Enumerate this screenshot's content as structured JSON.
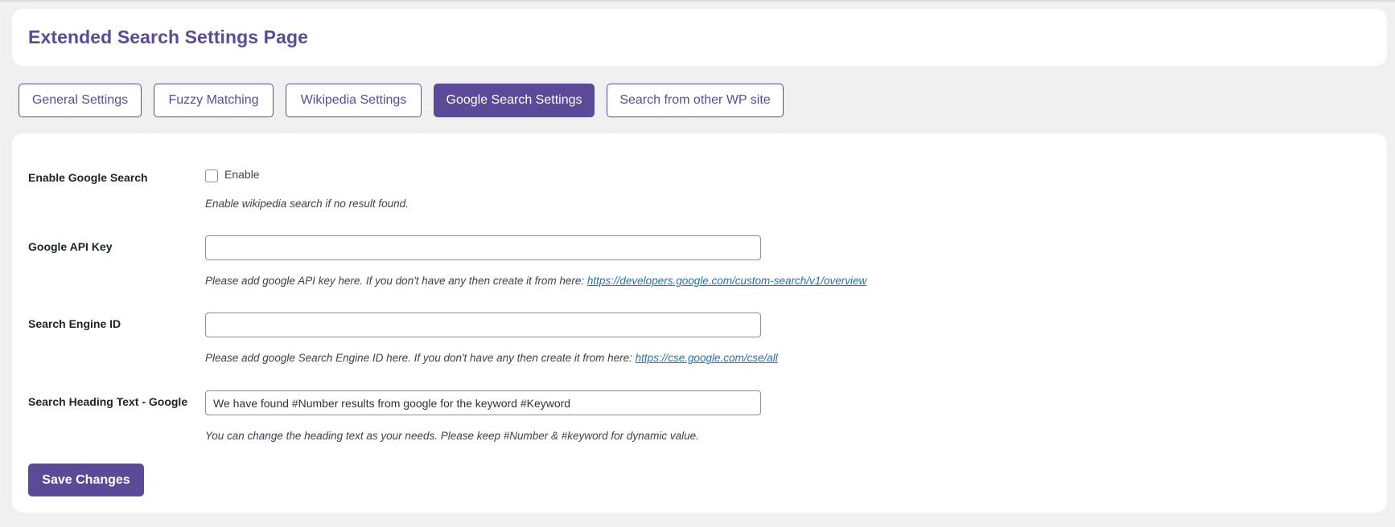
{
  "page": {
    "title": "Extended Search Settings Page"
  },
  "tabs": [
    {
      "label": "General Settings",
      "active": false
    },
    {
      "label": "Fuzzy Matching",
      "active": false
    },
    {
      "label": "Wikipedia Settings",
      "active": false
    },
    {
      "label": "Google Search Settings",
      "active": true
    },
    {
      "label": "Search from other WP site",
      "active": false
    }
  ],
  "form": {
    "enable_google": {
      "label": "Enable Google Search",
      "checkbox_label": "Enable",
      "checked": false,
      "description": "Enable wikipedia search if no result found."
    },
    "api_key": {
      "label": "Google API Key",
      "value": "",
      "description": "Please add google API key here. If you don't have any then create it from here: ",
      "link_text": "https://developers.google.com/custom-search/v1/overview"
    },
    "engine_id": {
      "label": "Search Engine ID",
      "value": "",
      "description": "Please add google Search Engine ID here. If you don't have any then create it from here: ",
      "link_text": "https://cse.google.com/cse/all"
    },
    "heading_text": {
      "label": "Search Heading Text - Google",
      "value": "We have found #Number results from google for the keyword #Keyword",
      "description": "You can change the heading text as your needs. Please keep #Number & #keyword for dynamic value."
    },
    "save_label": "Save Changes"
  },
  "colors": {
    "accent": "#5b4a98",
    "background": "#f0f0f1",
    "link": "#2271b1"
  }
}
